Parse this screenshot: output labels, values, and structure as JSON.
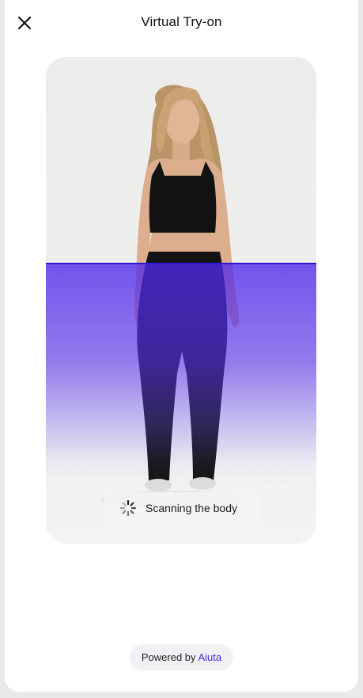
{
  "header": {
    "title": "Virtual Try-on",
    "close_icon": "close-icon"
  },
  "scan": {
    "status_text": "Scanning the body",
    "spinner_icon": "spinner-icon",
    "accent_color": "#2f14d6"
  },
  "footer": {
    "powered_prefix": "Powered by",
    "brand_name": "Aiuta",
    "brand_color": "#4a2fd8"
  }
}
